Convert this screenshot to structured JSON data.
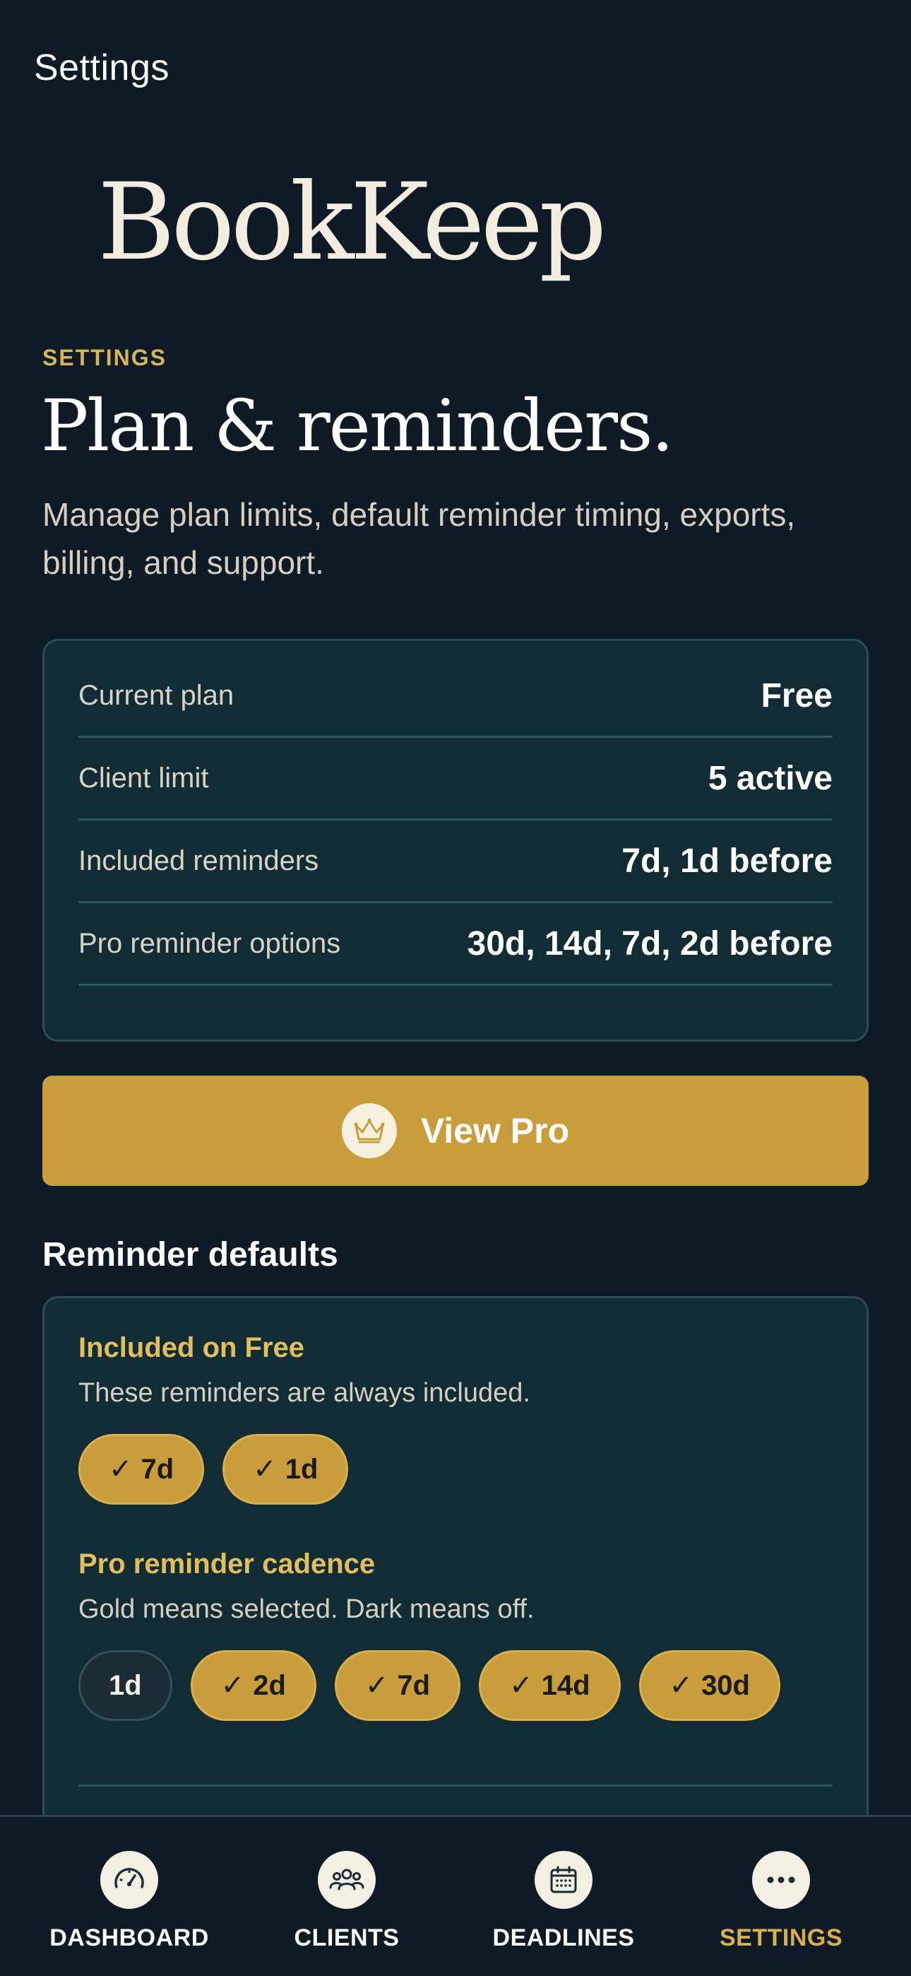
{
  "nav": {
    "title": "Settings"
  },
  "brand": {
    "logo_text": "BookKeep"
  },
  "page": {
    "eyebrow": "SETTINGS",
    "headline": "Plan & reminders.",
    "subtitle": "Manage plan limits, default reminder timing, exports, billing, and support."
  },
  "plan": {
    "rows": [
      {
        "label": "Current plan",
        "value": "Free"
      },
      {
        "label": "Client limit",
        "value": "5 active"
      },
      {
        "label": "Included reminders",
        "value": "7d, 1d before"
      },
      {
        "label": "Pro reminder options",
        "value": "30d, 14d, 7d, 2d before"
      }
    ],
    "button_label": "View Pro",
    "button_icon": "crown-icon"
  },
  "reminders": {
    "heading": "Reminder defaults",
    "free": {
      "title": "Included on Free",
      "description": "These reminders are always included.",
      "chips": [
        {
          "label": "7d",
          "selected": true
        },
        {
          "label": "1d",
          "selected": true
        }
      ]
    },
    "pro": {
      "title": "Pro reminder cadence",
      "description": "Gold means selected. Dark means off.",
      "chips": [
        {
          "label": "1d",
          "selected": false
        },
        {
          "label": "2d",
          "selected": true
        },
        {
          "label": "7d",
          "selected": true
        },
        {
          "label": "14d",
          "selected": true
        },
        {
          "label": "30d",
          "selected": true
        }
      ]
    },
    "check_glyph": "✓"
  },
  "tabs": [
    {
      "label": "DASHBOARD",
      "icon": "gauge-icon",
      "active": false
    },
    {
      "label": "CLIENTS",
      "icon": "people-icon",
      "active": false
    },
    {
      "label": "DEADLINES",
      "icon": "calendar-icon",
      "active": false
    },
    {
      "label": "SETTINGS",
      "icon": "more-icon",
      "active": true
    }
  ],
  "colors": {
    "background": "#0e1a26",
    "card": "#122c35",
    "gold": "#c99d3c",
    "accent_text": "#d8b458"
  }
}
